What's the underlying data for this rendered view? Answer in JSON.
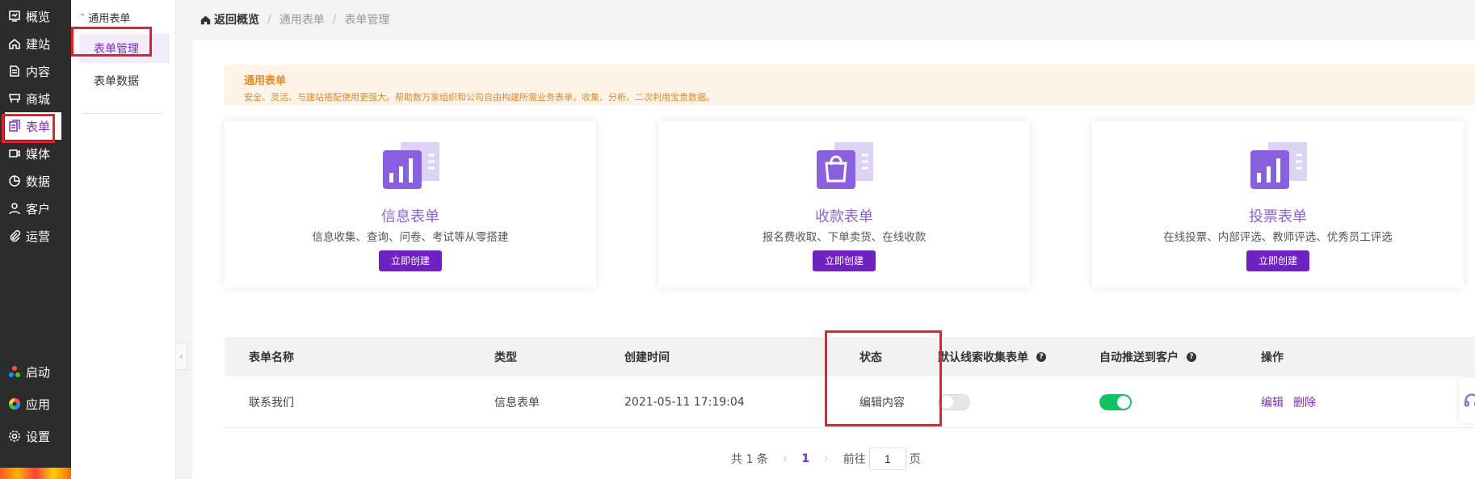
{
  "nav": {
    "items": [
      {
        "label": "概览",
        "icon": "overview-icon"
      },
      {
        "label": "建站",
        "icon": "home-icon"
      },
      {
        "label": "内容",
        "icon": "document-icon"
      },
      {
        "label": "商城",
        "icon": "cart-icon"
      },
      {
        "label": "表单",
        "icon": "form-icon"
      },
      {
        "label": "媒体",
        "icon": "video-icon"
      },
      {
        "label": "数据",
        "icon": "pie-icon"
      },
      {
        "label": "客户",
        "icon": "user-icon"
      },
      {
        "label": "运营",
        "icon": "paperclip-icon"
      }
    ],
    "bottom": [
      {
        "label": "启动",
        "icon": "launch-icon"
      },
      {
        "label": "应用",
        "icon": "apps-icon"
      },
      {
        "label": "设置",
        "icon": "gear-icon"
      }
    ]
  },
  "submenu": {
    "group": "通用表单",
    "items": [
      "表单管理",
      "表单数据"
    ]
  },
  "breadcrumb": {
    "home": "返回概览",
    "crumbs": [
      "通用表单",
      "表单管理"
    ]
  },
  "notice": {
    "title": "通用表单",
    "text": "安全、灵活、与建站搭配使用更强大。帮助数万家组织和公司自由构建所需业务表单，收集、分析、二次利用宝贵数据。"
  },
  "cards": [
    {
      "title": "信息表单",
      "desc": "信息收集、查询、问卷、考试等从零搭建",
      "button": "立即创建",
      "icon": "bar-chart-icon"
    },
    {
      "title": "收款表单",
      "desc": "报名费收取、下单卖货、在线收款",
      "button": "立即创建",
      "icon": "shopping-bag-icon"
    },
    {
      "title": "投票表单",
      "desc": "在线投票、内部评选、教师评选、优秀员工评选",
      "button": "立即创建",
      "icon": "bar-chart-icon"
    }
  ],
  "table": {
    "headers": [
      "表单名称",
      "类型",
      "创建时间",
      "状态",
      "默认线索收集表单",
      "自动推送到客户",
      "操作"
    ],
    "rows": [
      {
        "name": "联系我们",
        "type": "信息表单",
        "created": "2021-05-11 17:19:04",
        "status": "编辑内容",
        "default_lead": false,
        "auto_push": true,
        "actions": [
          "编辑",
          "删除"
        ]
      }
    ]
  },
  "pager": {
    "total": "共 1 条",
    "prev": "‹",
    "current": "1",
    "next": "›",
    "goto": "前往",
    "input": "1",
    "unit": "页"
  },
  "colors": {
    "accent": "#6f22c2",
    "highlight": "#e5222b",
    "toggle_on": "#13c264"
  }
}
